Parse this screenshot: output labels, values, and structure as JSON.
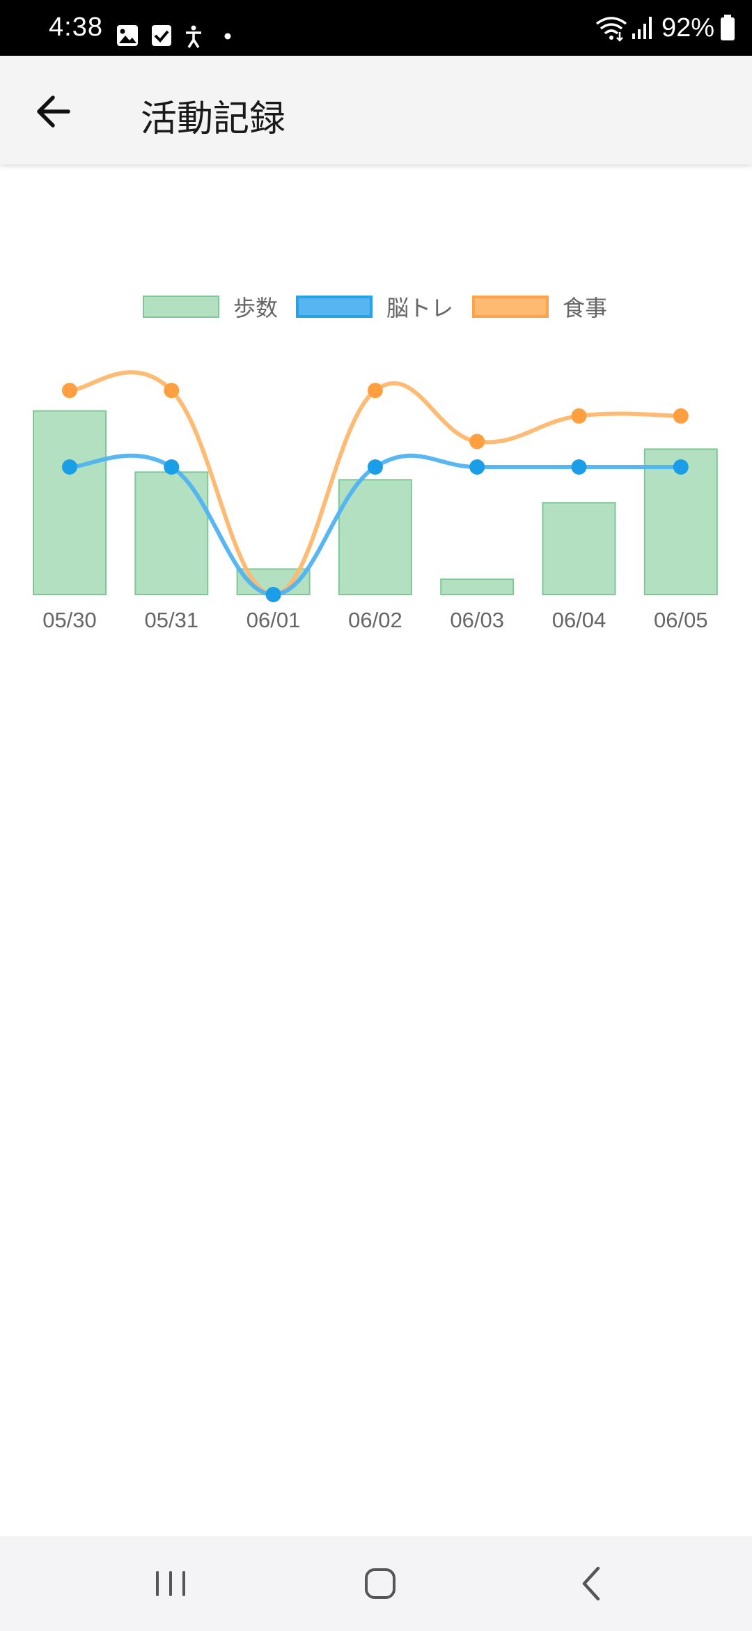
{
  "status_bar": {
    "time": "4:38",
    "battery": "92%",
    "icons_left": [
      "image-icon",
      "check-box-icon",
      "accessibility-icon",
      "dot-icon"
    ],
    "icons_right": [
      "wifi-icon",
      "signal-icon",
      "battery-icon"
    ]
  },
  "app_bar": {
    "back_icon": "arrow-left-icon",
    "title": "活動記録"
  },
  "chart_data": {
    "type": "bar",
    "categories": [
      "05/30",
      "05/31",
      "06/01",
      "06/02",
      "06/03",
      "06/04",
      "06/05"
    ],
    "series": [
      {
        "name": "歩数",
        "type": "bar",
        "values": [
          72,
          48,
          10,
          45,
          6,
          36,
          57
        ],
        "color": "#b3e0c1",
        "border": "#7fc796"
      },
      {
        "name": "脳トレ",
        "type": "line",
        "values": [
          50,
          50,
          0,
          50,
          50,
          50,
          50
        ],
        "color": "#4fb3f2",
        "point_color": "#1a9ee8"
      },
      {
        "name": "食事",
        "type": "line",
        "values": [
          80,
          80,
          0,
          80,
          60,
          70,
          70
        ],
        "color": "#ffb76b",
        "point_color": "#ff9f40"
      }
    ],
    "ylim": [
      0,
      100
    ],
    "legend": "top-center",
    "grid": false
  },
  "nav_bar": {
    "recents_icon": "recents-icon",
    "home_icon": "home-icon",
    "back_icon": "back-chevron-icon"
  }
}
